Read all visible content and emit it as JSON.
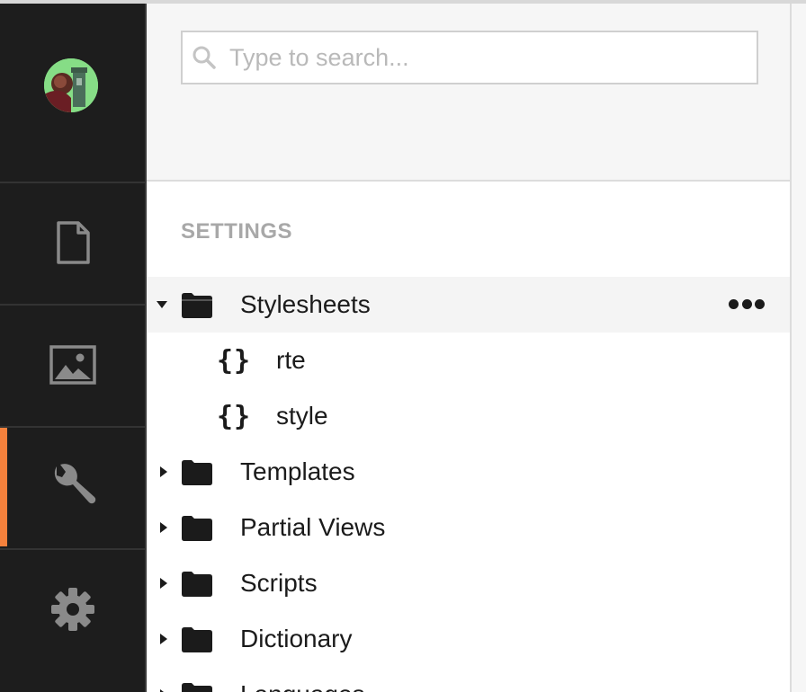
{
  "search": {
    "placeholder": "Type to search..."
  },
  "sections": [
    {
      "name": "content",
      "icon": "document-icon",
      "active": false
    },
    {
      "name": "media",
      "icon": "image-icon",
      "active": false
    },
    {
      "name": "settings",
      "icon": "wrench-icon",
      "active": true
    },
    {
      "name": "developer",
      "icon": "gear-icon",
      "active": false
    }
  ],
  "tree": {
    "title": "SETTINGS",
    "items": [
      {
        "label": "Stylesheets",
        "expanded": true
      },
      {
        "label": "rte"
      },
      {
        "label": "style"
      },
      {
        "label": "Templates",
        "expanded": false
      },
      {
        "label": "Partial Views",
        "expanded": false
      },
      {
        "label": "Scripts",
        "expanded": false
      },
      {
        "label": "Dictionary",
        "expanded": false
      },
      {
        "label": "Languages",
        "expanded": false
      }
    ],
    "child_icon": "{}"
  },
  "colors": {
    "sidebar_bg": "#1d1d1d",
    "active_accent": "#f5813c",
    "icon_gray": "#8a8a8a",
    "title_gray": "#a8a8a8"
  }
}
